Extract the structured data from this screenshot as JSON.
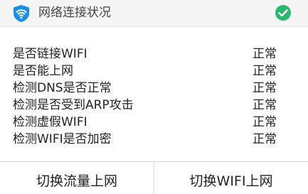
{
  "header": {
    "title": "网络连接状况",
    "icon": "wifi-shield-icon",
    "status_icon": "check-circle-icon",
    "brand_color": "#1a8fe3",
    "ok_color": "#2ab86f"
  },
  "checks": [
    {
      "label": "是否链接WIFI",
      "status": "正常"
    },
    {
      "label": "是否能上网",
      "status": "正常"
    },
    {
      "label": "检测DNS是否正常",
      "status": "正常"
    },
    {
      "label": "检测是否受到ARP攻击",
      "status": "正常"
    },
    {
      "label": "检测虚假WIFI",
      "status": "正常"
    },
    {
      "label": "检测WIFI是否加密",
      "status": "正常"
    }
  ],
  "footer": {
    "left_button": "切换流量上网",
    "right_button": "切换WIFI上网"
  }
}
